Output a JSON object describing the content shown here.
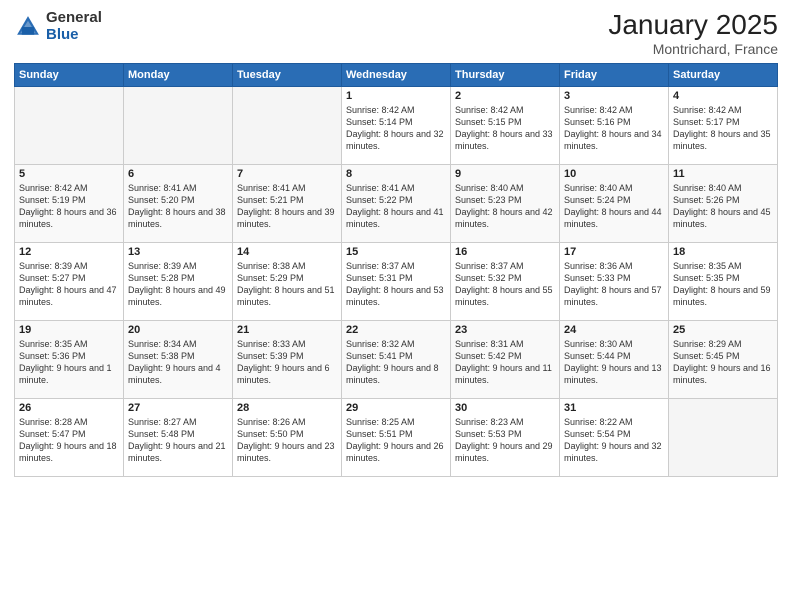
{
  "logo": {
    "general": "General",
    "blue": "Blue"
  },
  "title": "January 2025",
  "location": "Montrichard, France",
  "weekdays": [
    "Sunday",
    "Monday",
    "Tuesday",
    "Wednesday",
    "Thursday",
    "Friday",
    "Saturday"
  ],
  "weeks": [
    [
      {
        "day": null
      },
      {
        "day": null
      },
      {
        "day": null
      },
      {
        "day": "1",
        "sunrise": "8:42 AM",
        "sunset": "5:14 PM",
        "daylight": "8 hours and 32 minutes."
      },
      {
        "day": "2",
        "sunrise": "8:42 AM",
        "sunset": "5:15 PM",
        "daylight": "8 hours and 33 minutes."
      },
      {
        "day": "3",
        "sunrise": "8:42 AM",
        "sunset": "5:16 PM",
        "daylight": "8 hours and 34 minutes."
      },
      {
        "day": "4",
        "sunrise": "8:42 AM",
        "sunset": "5:17 PM",
        "daylight": "8 hours and 35 minutes."
      }
    ],
    [
      {
        "day": "5",
        "sunrise": "8:42 AM",
        "sunset": "5:19 PM",
        "daylight": "8 hours and 36 minutes."
      },
      {
        "day": "6",
        "sunrise": "8:41 AM",
        "sunset": "5:20 PM",
        "daylight": "8 hours and 38 minutes."
      },
      {
        "day": "7",
        "sunrise": "8:41 AM",
        "sunset": "5:21 PM",
        "daylight": "8 hours and 39 minutes."
      },
      {
        "day": "8",
        "sunrise": "8:41 AM",
        "sunset": "5:22 PM",
        "daylight": "8 hours and 41 minutes."
      },
      {
        "day": "9",
        "sunrise": "8:40 AM",
        "sunset": "5:23 PM",
        "daylight": "8 hours and 42 minutes."
      },
      {
        "day": "10",
        "sunrise": "8:40 AM",
        "sunset": "5:24 PM",
        "daylight": "8 hours and 44 minutes."
      },
      {
        "day": "11",
        "sunrise": "8:40 AM",
        "sunset": "5:26 PM",
        "daylight": "8 hours and 45 minutes."
      }
    ],
    [
      {
        "day": "12",
        "sunrise": "8:39 AM",
        "sunset": "5:27 PM",
        "daylight": "8 hours and 47 minutes."
      },
      {
        "day": "13",
        "sunrise": "8:39 AM",
        "sunset": "5:28 PM",
        "daylight": "8 hours and 49 minutes."
      },
      {
        "day": "14",
        "sunrise": "8:38 AM",
        "sunset": "5:29 PM",
        "daylight": "8 hours and 51 minutes."
      },
      {
        "day": "15",
        "sunrise": "8:37 AM",
        "sunset": "5:31 PM",
        "daylight": "8 hours and 53 minutes."
      },
      {
        "day": "16",
        "sunrise": "8:37 AM",
        "sunset": "5:32 PM",
        "daylight": "8 hours and 55 minutes."
      },
      {
        "day": "17",
        "sunrise": "8:36 AM",
        "sunset": "5:33 PM",
        "daylight": "8 hours and 57 minutes."
      },
      {
        "day": "18",
        "sunrise": "8:35 AM",
        "sunset": "5:35 PM",
        "daylight": "8 hours and 59 minutes."
      }
    ],
    [
      {
        "day": "19",
        "sunrise": "8:35 AM",
        "sunset": "5:36 PM",
        "daylight": "9 hours and 1 minute."
      },
      {
        "day": "20",
        "sunrise": "8:34 AM",
        "sunset": "5:38 PM",
        "daylight": "9 hours and 4 minutes."
      },
      {
        "day": "21",
        "sunrise": "8:33 AM",
        "sunset": "5:39 PM",
        "daylight": "9 hours and 6 minutes."
      },
      {
        "day": "22",
        "sunrise": "8:32 AM",
        "sunset": "5:41 PM",
        "daylight": "9 hours and 8 minutes."
      },
      {
        "day": "23",
        "sunrise": "8:31 AM",
        "sunset": "5:42 PM",
        "daylight": "9 hours and 11 minutes."
      },
      {
        "day": "24",
        "sunrise": "8:30 AM",
        "sunset": "5:44 PM",
        "daylight": "9 hours and 13 minutes."
      },
      {
        "day": "25",
        "sunrise": "8:29 AM",
        "sunset": "5:45 PM",
        "daylight": "9 hours and 16 minutes."
      }
    ],
    [
      {
        "day": "26",
        "sunrise": "8:28 AM",
        "sunset": "5:47 PM",
        "daylight": "9 hours and 18 minutes."
      },
      {
        "day": "27",
        "sunrise": "8:27 AM",
        "sunset": "5:48 PM",
        "daylight": "9 hours and 21 minutes."
      },
      {
        "day": "28",
        "sunrise": "8:26 AM",
        "sunset": "5:50 PM",
        "daylight": "9 hours and 23 minutes."
      },
      {
        "day": "29",
        "sunrise": "8:25 AM",
        "sunset": "5:51 PM",
        "daylight": "9 hours and 26 minutes."
      },
      {
        "day": "30",
        "sunrise": "8:23 AM",
        "sunset": "5:53 PM",
        "daylight": "9 hours and 29 minutes."
      },
      {
        "day": "31",
        "sunrise": "8:22 AM",
        "sunset": "5:54 PM",
        "daylight": "9 hours and 32 minutes."
      },
      {
        "day": null
      }
    ]
  ]
}
